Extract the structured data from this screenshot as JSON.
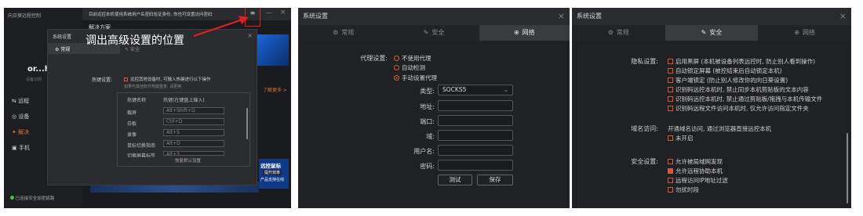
{
  "panel1": {
    "app_title": "向日葵远程控制",
    "notice": "目前远控本机使用系统用户名密码验证身份, 你也可设置访问密码",
    "notice_link": "访问密码",
    "solution_label": "解决方案",
    "user": "or...hj",
    "device_label": "设备识别",
    "menu": [
      "远程",
      "设备",
      "解决",
      "手机"
    ],
    "status": "已连接安全加密链路",
    "annotation": "调出高级设置的位置",
    "menu_icon": "≡",
    "dialog": {
      "title": "系统设置",
      "tabs": [
        "常规",
        "安全"
      ],
      "hotkey_label": "热键设置:",
      "hotkey_check": "远控其他设备时, 可输入热键进行以下操作",
      "hotkey_sub": "如果与其他软件热键重复, 请更换",
      "col1": "热键名称",
      "col2": "热键(在键盘上输入)",
      "rows": [
        {
          "name": "截屏",
          "key": "Alt+Shift+Q"
        },
        {
          "name": "白板",
          "key": "Ctrl+D"
        },
        {
          "name": "录像",
          "key": "Alt+S"
        },
        {
          "name": "鼠标切换指南",
          "key": "Alt+D"
        },
        {
          "name": "切换屏幕标签",
          "key": "Alt+3"
        }
      ],
      "restore": "恢复默认设置"
    },
    "learn_more": "了解更多 >",
    "promo_title": "远控鼠标",
    "promo_btn": "提升效率",
    "promo_sub": "产品支持在线"
  },
  "panel2": {
    "title": "系统设置",
    "tabs": [
      "常规",
      "安全",
      "网络"
    ],
    "proxy_label": "代理设置:",
    "options": [
      "不使用代理",
      "自动检测",
      "手动设置代理"
    ],
    "type_label": "类型:",
    "type_value": "SOCKS5",
    "fields": [
      "地址:",
      "端口:",
      "域:",
      "用户名:",
      "密码:"
    ],
    "test_btn": "测试",
    "save_btn": "保存"
  },
  "panel3": {
    "title": "系统设置",
    "tabs": [
      "常规",
      "安全",
      "网络"
    ],
    "privacy_label": "隐私设置:",
    "privacy_items": [
      "启用黑屏 (本机被设备列表远控时, 防止别人看到操作)",
      "自动锁定屏幕 (被控结束后自动锁定本机)",
      "客户端锁定 (防止别人修改你的向日葵设置)",
      "识别码远控本机时, 禁止同步本机剪贴板的文本内容",
      "识别码远控本机时, 禁止通过剪贴板/拖拽与本机传输文件",
      "识别码远程文件访问本机时, 仅允许访问指定文件夹"
    ],
    "domain_label": "域名访问:",
    "domain_text": "开通域名访问, 通过浏览器直接远控本机",
    "domain_check": "未开启",
    "security_label": "安全设置:",
    "security_items": [
      {
        "text": "允许被局域网发现",
        "checked": false
      },
      {
        "text": "允许远程协助本机",
        "checked": true
      },
      {
        "text": "远程访问IP地址过滤",
        "checked": false
      },
      {
        "text": "勿扰时段",
        "checked": false
      }
    ]
  }
}
